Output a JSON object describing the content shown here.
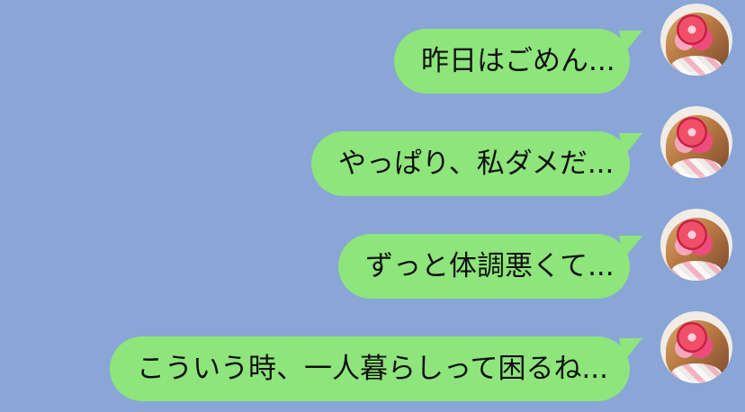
{
  "messages": [
    {
      "text": "昨日はごめん..."
    },
    {
      "text": "やっぱり、私ダメだ..."
    },
    {
      "text": "ずっと体調悪くて..."
    },
    {
      "text": "こういう時、一人暮らしって困るね..."
    }
  ],
  "colors": {
    "background": "#8aa6d6",
    "bubble": "#8de57b"
  },
  "icons": {
    "avatar": "user-avatar-icon"
  }
}
